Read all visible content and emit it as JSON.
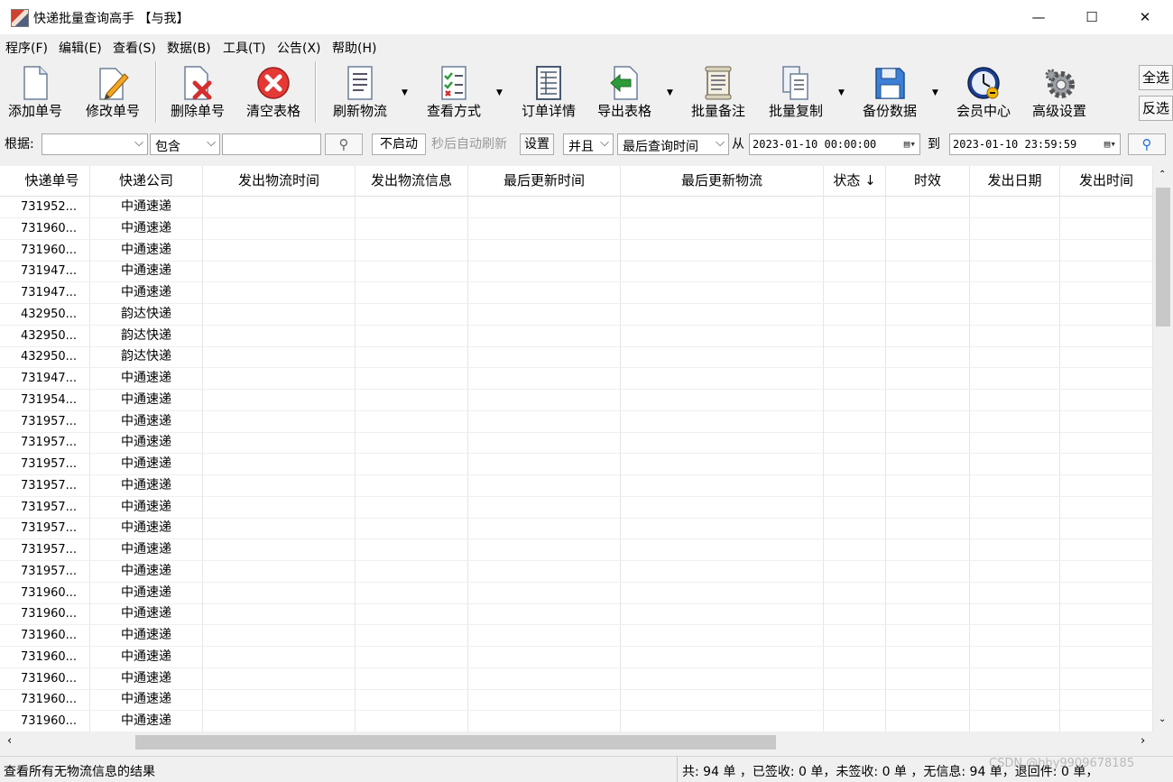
{
  "window": {
    "title": "快递批量查询高手 【与我】",
    "minimize": "—",
    "maximize": "☐",
    "close": "✕"
  },
  "menu": [
    "程序(F)",
    "编辑(E)",
    "查看(S)",
    "数据(B)",
    "工具(T)",
    "公告(X)",
    "帮助(H)"
  ],
  "toolbar": {
    "add": "添加单号",
    "edit": "修改单号",
    "delete": "删除单号",
    "clear": "清空表格",
    "refresh": "刷新物流",
    "view_mode": "查看方式",
    "order_detail": "订单详情",
    "export": "导出表格",
    "batch_note": "批量备注",
    "batch_copy": "批量复制",
    "backup": "备份数据",
    "member": "会员中心",
    "advanced": "高级设置",
    "select_all": "全选",
    "invert": "反选"
  },
  "filter": {
    "basis_label": "根据:",
    "basis_value": "",
    "match": "包含",
    "keyword": "",
    "auto_status": "不启动",
    "auto_refresh_label": "秒后自动刷新",
    "settings": "设置",
    "logic": "并且",
    "time_field": "最后查询时间",
    "from_label": "从",
    "from_time": "2023-01-10 00:00:00",
    "to_label": "到",
    "to_time": "2023-01-10 23:59:59"
  },
  "table": {
    "columns": [
      "快递单号",
      "快递公司",
      "发出物流时间",
      "发出物流信息",
      "最后更新时间",
      "最后更新物流",
      "状态 ↓",
      "时效",
      "发出日期",
      "发出时间"
    ],
    "rows": [
      [
        "731952...",
        "中通速递"
      ],
      [
        "731960...",
        "中通速递"
      ],
      [
        "731960...",
        "中通速递"
      ],
      [
        "731947...",
        "中通速递"
      ],
      [
        "731947...",
        "中通速递"
      ],
      [
        "432950...",
        "韵达快递"
      ],
      [
        "432950...",
        "韵达快递"
      ],
      [
        "432950...",
        "韵达快递"
      ],
      [
        "731947...",
        "中通速递"
      ],
      [
        "731954...",
        "中通速递"
      ],
      [
        "731957...",
        "中通速递"
      ],
      [
        "731957...",
        "中通速递"
      ],
      [
        "731957...",
        "中通速递"
      ],
      [
        "731957...",
        "中通速递"
      ],
      [
        "731957...",
        "中通速递"
      ],
      [
        "731957...",
        "中通速递"
      ],
      [
        "731957...",
        "中通速递"
      ],
      [
        "731957...",
        "中通速递"
      ],
      [
        "731960...",
        "中通速递"
      ],
      [
        "731960...",
        "中通速递"
      ],
      [
        "731960...",
        "中通速递"
      ],
      [
        "731960...",
        "中通速递"
      ],
      [
        "731960...",
        "中通速递"
      ],
      [
        "731960...",
        "中通速递"
      ],
      [
        "731960...",
        "中通速递"
      ]
    ]
  },
  "status": {
    "left": "查看所有无物流信息的结果",
    "right": "共: 94 单 ，已签收: 0 单，未签收: 0 单 ，无信息: 94 单，退回件: 0 单，"
  },
  "watermark": "CSDN @hby9909678185",
  "colors": {
    "delete_red": "#d32f2f",
    "accent_blue": "#1e6fd9"
  }
}
